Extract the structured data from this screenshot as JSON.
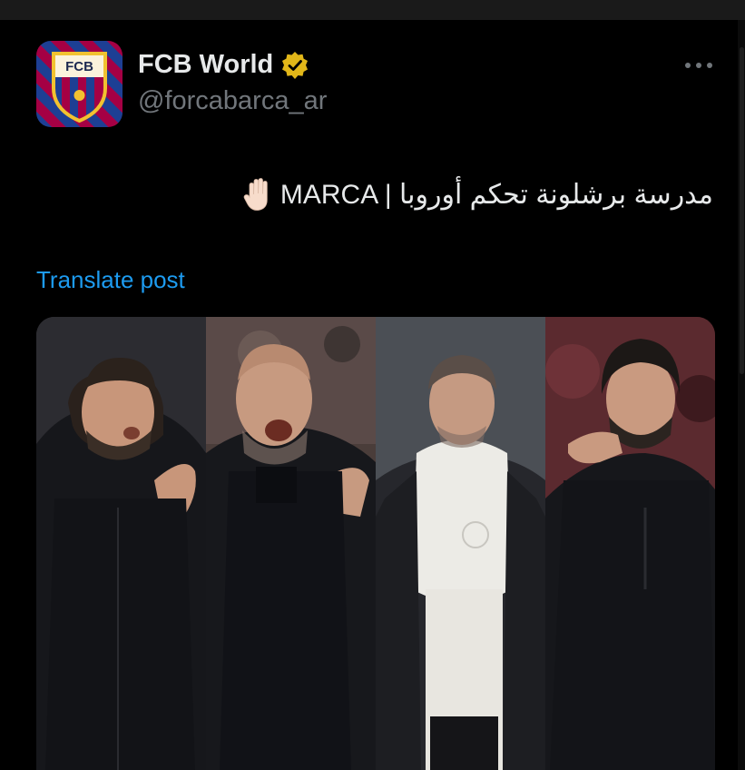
{
  "account": {
    "avatar_text": "FCB",
    "name": "FCB World",
    "handle": "@forcabarca_ar",
    "verified_icon": "gold-verified-badge-icon"
  },
  "post": {
    "text": "MARCA | مدرسة برشلونة تحكم أوروبا",
    "emoji": "raised-hand-emoji",
    "translate_label": "Translate post"
  },
  "media": {
    "panels": [
      "coach-photo-1",
      "coach-photo-2",
      "coach-photo-3",
      "coach-photo-4"
    ]
  },
  "colors": {
    "background": "#000000",
    "text": "#e7e9ea",
    "muted": "#71767b",
    "link": "#1d9bf0",
    "verified": "#e2b719",
    "barca_blue": "#1d3f94",
    "barca_red": "#a50044"
  }
}
